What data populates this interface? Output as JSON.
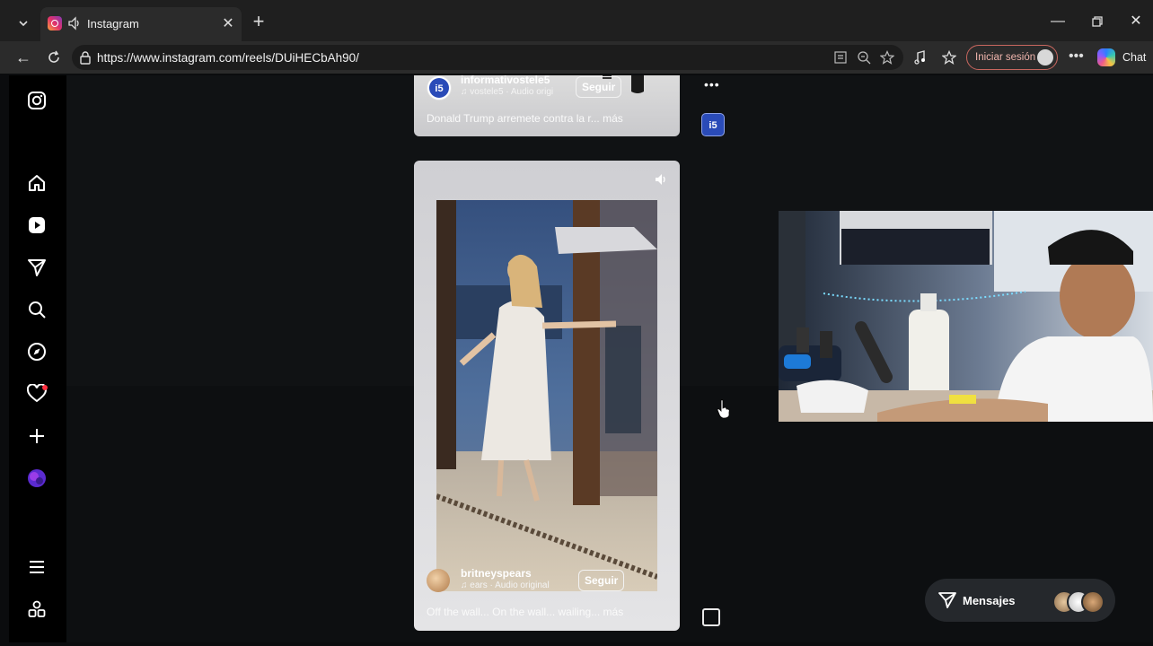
{
  "browser": {
    "tab_title": "Instagram",
    "url": "https://www.instagram.com/reels/DUiHECbAh90/",
    "sign_in_label": "Iniciar sesión",
    "chat_label": "Chat"
  },
  "reels": [
    {
      "username": "informativostele5",
      "audio": "vostele5 · Audio origi",
      "follow_label": "Seguir",
      "caption": "Donald Trump arremete contra la r... más"
    },
    {
      "username": "britneyspears",
      "audio": "ears · Audio original",
      "follow_label": "Seguir",
      "caption": "Off the wall... On the wall... wailing... más"
    }
  ],
  "messages": {
    "label": "Mensajes"
  },
  "colors": {
    "accent_signin": "#c9675f",
    "instagram_bg": "#000000",
    "notification_dot": "#ff3040"
  }
}
